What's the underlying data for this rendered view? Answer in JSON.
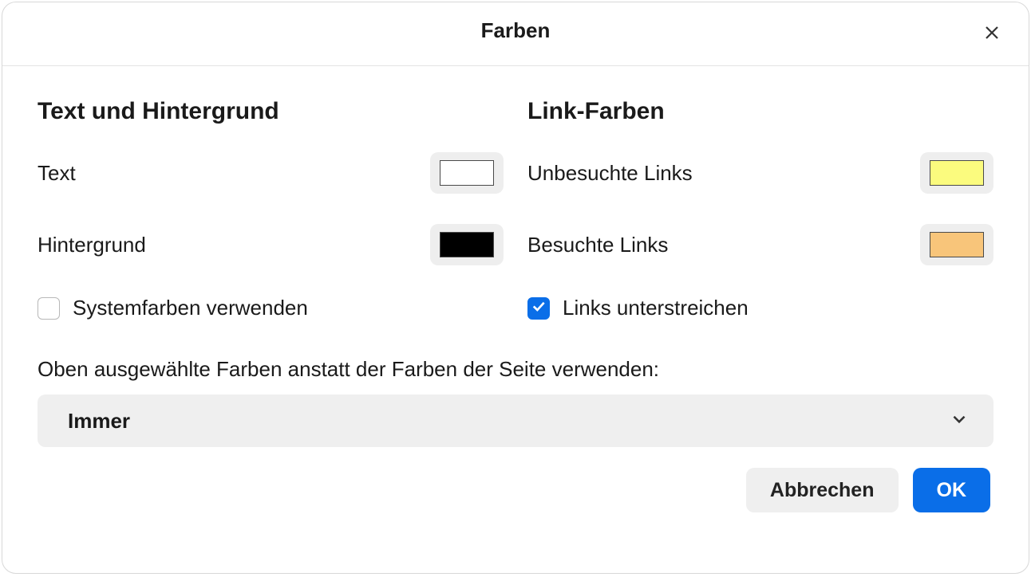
{
  "title": "Farben",
  "sections": {
    "text_bg": {
      "heading": "Text und Hintergrund",
      "text_label": "Text",
      "text_color": "#ffffff",
      "background_label": "Hintergrund",
      "background_color": "#000000",
      "use_system_label": "Systemfarben verwenden",
      "use_system_checked": false
    },
    "links": {
      "heading": "Link-Farben",
      "unvisited_label": "Unbesuchte Links",
      "unvisited_color": "#fbfb7e",
      "visited_label": "Besuchte Links",
      "visited_color": "#f8c57a",
      "underline_label": "Links unterstreichen",
      "underline_checked": true
    }
  },
  "override": {
    "label": "Oben ausgewählte Farben anstatt der Farben der Seite verwenden:",
    "selected": "Immer"
  },
  "buttons": {
    "cancel": "Abbrechen",
    "ok": "OK"
  }
}
